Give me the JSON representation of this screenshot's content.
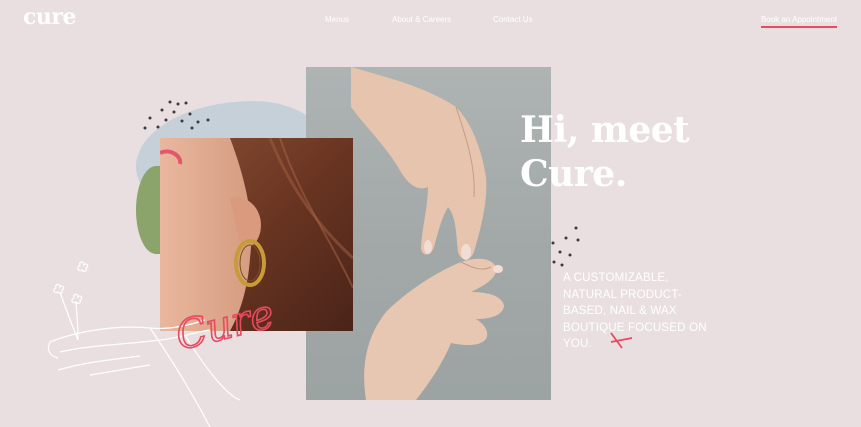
{
  "nav": {
    "logo": "cure",
    "links": [
      {
        "label": "Menus"
      },
      {
        "label": "About & Careers"
      },
      {
        "label": "Contact Us"
      }
    ],
    "cta": "Book an Appointment"
  },
  "hero": {
    "title_line1": "Hi, meet",
    "title_line2": "Cure.",
    "subtitle": "A CUSTOMIZABLE, NATURAL PRODUCT-BASED, NAIL & WAX BOUTIQUE FOCUSED ON YOU."
  },
  "accent": {
    "signature": "Cure"
  },
  "colors": {
    "background": "#e9dfe0",
    "accent_red": "#e84a5f",
    "blob_blue": "#c6d0d9",
    "blob_green": "#8aa46c",
    "hands_bg": "#a6acab"
  },
  "icons": [
    "logo",
    "dots-decoration",
    "hand-line-drawing",
    "flower-line-drawing",
    "x-mark-icon"
  ]
}
